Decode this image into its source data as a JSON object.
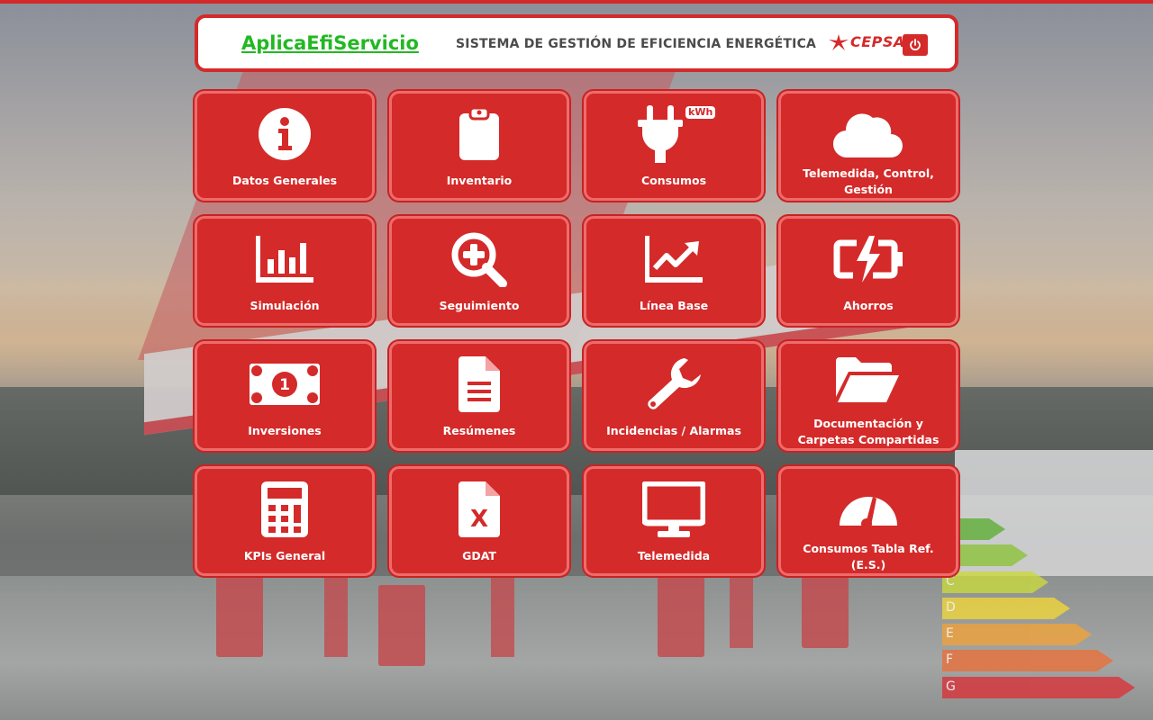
{
  "header": {
    "app_title": "AplicaEfiServicio",
    "subtitle": "SISTEMA DE GESTIÓN DE EFICIENCIA ENERGÉTICA",
    "logo_text": "CEPSA",
    "power_icon": "power-icon"
  },
  "colors": {
    "brand_red": "#d42a2a",
    "title_green": "#23b823",
    "tile_border": "#ee6b6b"
  },
  "tiles": [
    {
      "label": "Datos Generales",
      "icon": "info-circle-icon"
    },
    {
      "label": "Inventario",
      "icon": "clipboard-icon"
    },
    {
      "label": "Consumos",
      "icon": "plug-icon",
      "badge": "kWh"
    },
    {
      "label": "Telemedida, Control, Gestión",
      "icon": "cloud-icon"
    },
    {
      "label": "Simulación",
      "icon": "bar-chart-icon"
    },
    {
      "label": "Seguimiento",
      "icon": "search-plus-icon"
    },
    {
      "label": "Línea Base",
      "icon": "line-chart-icon"
    },
    {
      "label": "Ahorros",
      "icon": "battery-charge-icon"
    },
    {
      "label": "Inversiones",
      "icon": "money-bill-icon",
      "badge": "1"
    },
    {
      "label": "Resúmenes",
      "icon": "document-icon"
    },
    {
      "label": "Incidencias / Alarmas",
      "icon": "wrench-icon"
    },
    {
      "label": "Documentación y Carpetas Compartidas",
      "icon": "folder-open-icon"
    },
    {
      "label": "KPIs General",
      "icon": "calculator-icon"
    },
    {
      "label": "GDAT",
      "icon": "excel-file-icon",
      "badge": "X"
    },
    {
      "label": "Telemedida",
      "icon": "monitor-icon"
    },
    {
      "label": "Consumos Tabla Ref. (E.S.)",
      "icon": "gauge-icon"
    }
  ],
  "background": {
    "energy_labels": [
      "C",
      "D",
      "E",
      "F",
      "G"
    ]
  }
}
